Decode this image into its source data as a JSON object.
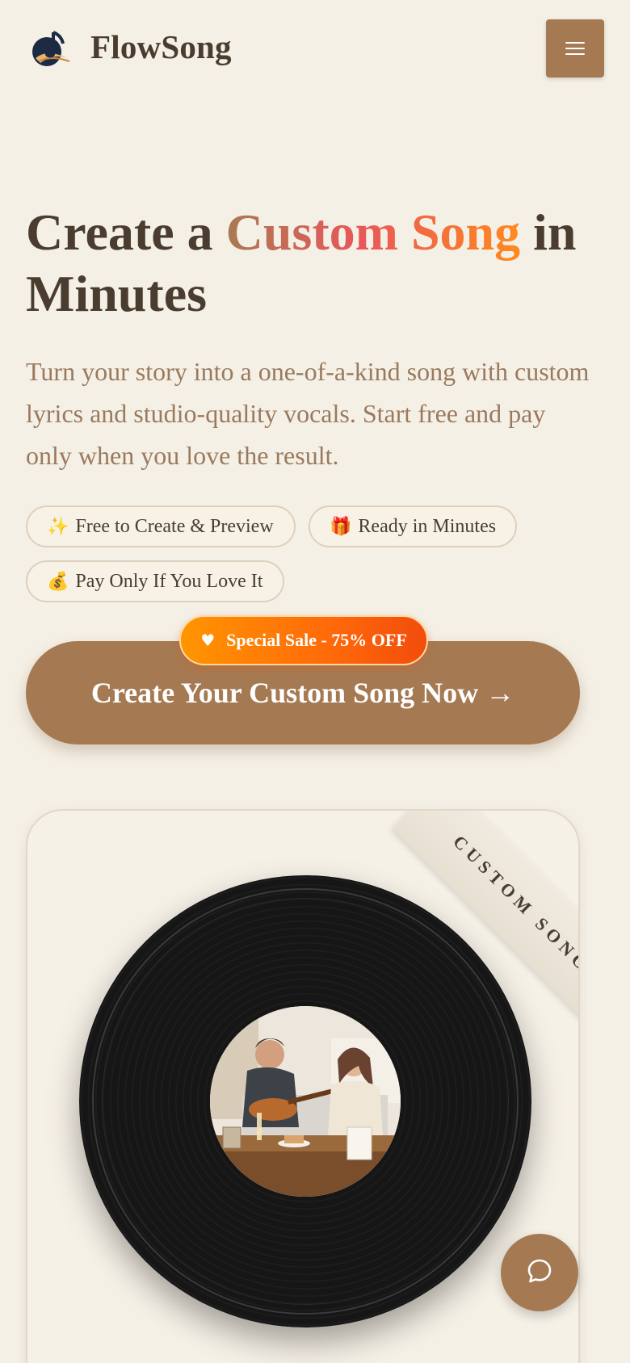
{
  "header": {
    "brand": "FlowSong",
    "logo_icon": "music-note-logo-icon",
    "menu_icon": "hamburger-menu-icon"
  },
  "hero": {
    "title_prefix": "Create a ",
    "title_highlight": "Custom Song",
    "title_suffix": " in Minutes",
    "subtitle": "Turn your story into a one-of-a-kind song with custom lyrics and studio-quality vocals. Start free and pay only when you love the result."
  },
  "pills": [
    {
      "emoji": "✨",
      "label": "Free to Create & Preview"
    },
    {
      "emoji": "🎁",
      "label": "Ready in Minutes"
    },
    {
      "emoji": "💰",
      "label": "Pay Only If You Love It"
    }
  ],
  "cta": {
    "badge_icon": "♥",
    "badge_label": "Special Sale - 75% OFF",
    "button_label": "Create Your Custom Song Now →"
  },
  "card": {
    "ribbon_label": "CUSTOM SONG",
    "image_description_icon": "vinyl-record-photo"
  },
  "chat": {
    "icon": "chat-bubble-icon"
  },
  "colors": {
    "background": "#f5f0e6",
    "brand_brown": "#a57a53",
    "text_dark": "#4a3d30",
    "text_muted": "#9a7a5e",
    "sale_orange": "#ff7a0a"
  }
}
